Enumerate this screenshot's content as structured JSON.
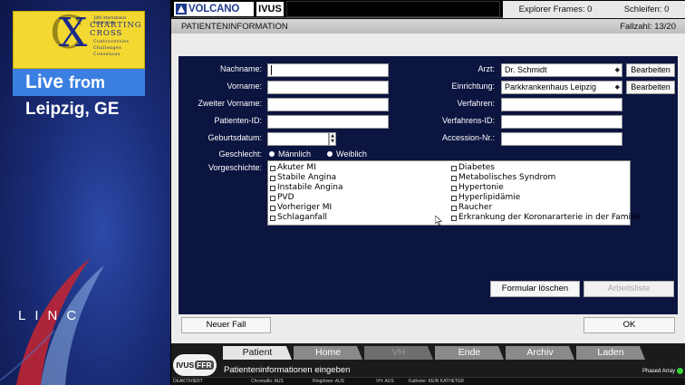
{
  "broadcast": {
    "logo_top_text": "10th International Symposium",
    "logo_word1": "CHARTING",
    "logo_word2": "CROSS",
    "logo_sub": [
      "Controversies",
      "Challenges",
      "Consensus"
    ],
    "live_word": "Live",
    "live_from": "from",
    "location": "Leipzig, GE",
    "linc": "LINC"
  },
  "topbar": {
    "brand": "VOLCANO",
    "mode": "IVUS",
    "explorer_frames": "Explorer Frames: 0",
    "loops": "Schleifen: 0"
  },
  "titlebar": {
    "title": "PATIENTENINFORMATION",
    "case_number": "Fallzahl: 13/20"
  },
  "form": {
    "labels": {
      "last_name": "Nachname:",
      "first_name": "Vorname:",
      "middle_name": "Zweiter Vorname:",
      "patient_id": "Patienten-ID:",
      "dob": "Geburtsdatum:",
      "sex": "Geschlecht:",
      "history": "Vorgeschichte:",
      "physician": "Arzt:",
      "facility": "Einrichtung:",
      "procedure": "Verfahren:",
      "procedure_id": "Verfahrens-ID:",
      "accession": "Accession-Nr.:"
    },
    "values": {
      "last_name": "",
      "first_name": "",
      "middle_name": "",
      "patient_id": "",
      "dob": "",
      "procedure": "",
      "procedure_id": "",
      "accession": ""
    },
    "physician_selected": "Dr. Schmidt",
    "facility_selected": "Parkkrankenhaus Leipzig",
    "edit_label": "Bearbeiten",
    "sex_options": [
      "Männlich",
      "Weiblich"
    ],
    "history_left": [
      "Akuter MI",
      "Stabile Angina",
      "Instabile Angina",
      "PVD",
      "Vorheriger MI",
      "Schlaganfall"
    ],
    "history_right": [
      "Diabetes",
      "Metabolisches Syndrom",
      "Hypertonie",
      "Hyperlipidämie",
      "Raucher",
      "Erkrankung der Koronararterie in der Familie"
    ],
    "clear_form": "Formular löschen",
    "worklist": "Arbeitsliste"
  },
  "actions": {
    "new_case": "Neuer Fall",
    "ok": "OK"
  },
  "nav": {
    "logo_a": "IVUS",
    "logo_b": "FFR",
    "tabs": [
      "Patient",
      "Home",
      "VH",
      "Ende",
      "Archiv",
      "Laden"
    ],
    "status": "Patienteninformationen eingeben",
    "phased_array": "Phased Array"
  },
  "statusbar": {
    "items": [
      "DEAKTIVIERT",
      "Chromaflo: AUS",
      "Ringdown: AUS",
      "VH: AUS",
      "Katheter: KEIN KATHETER"
    ]
  },
  "colors": {
    "form_panel": "#0c1440",
    "brand_blue": "#1e3a8c",
    "live_bar": "#3b7fe0",
    "logo_yellow": "#f3d832",
    "status_green": "#3ad13a"
  }
}
